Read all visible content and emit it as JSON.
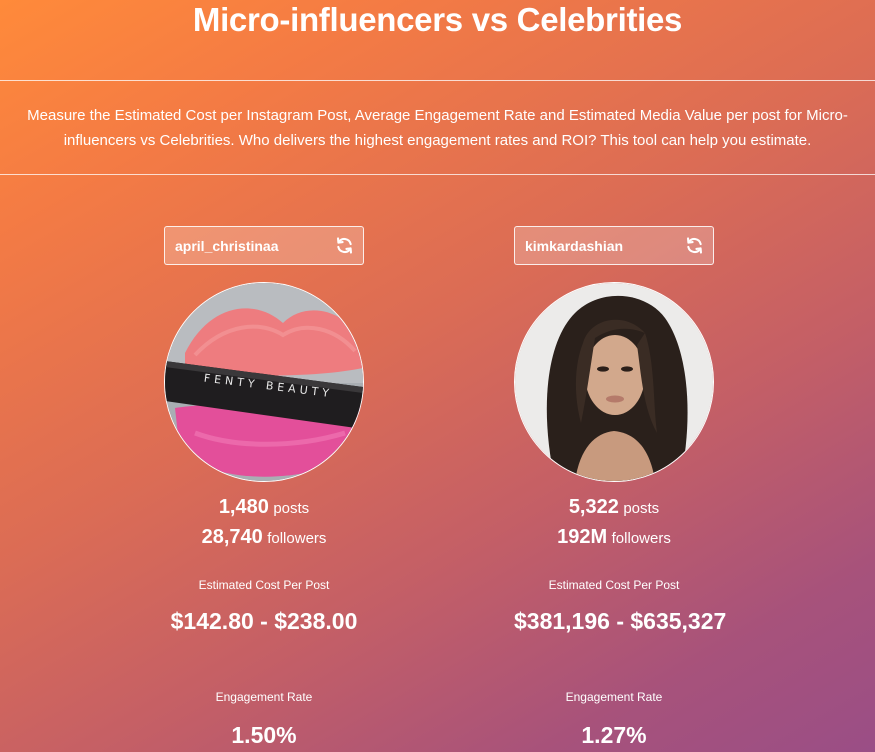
{
  "header": {
    "title": "Micro-influencers vs Celebrities",
    "description": "Measure the Estimated Cost per Instagram Post, Average Engagement Rate and Estimated Media Value per post for Micro-influencers vs Celebrities. Who delivers the highest engagement rates and ROI? This tool can help you estimate."
  },
  "influencers": [
    {
      "handle": "april_christinaa",
      "posts_count": "1,480",
      "posts_label": "posts",
      "followers_count": "28,740",
      "followers_label": "followers",
      "cost_label": "Estimated Cost Per Post",
      "cost_value": "$142.80 - $238.00",
      "engagement_label": "Engagement Rate",
      "engagement_value": "1.50%"
    },
    {
      "handle": "kimkardashian",
      "posts_count": "5,322",
      "posts_label": "posts",
      "followers_count": "192M",
      "followers_label": "followers",
      "cost_label": "Estimated Cost Per Post",
      "cost_value": "$381,196 - $635,327",
      "engagement_label": "Engagement Rate",
      "engagement_value": "1.27%"
    }
  ],
  "icons": {
    "refresh": "refresh-icon"
  }
}
